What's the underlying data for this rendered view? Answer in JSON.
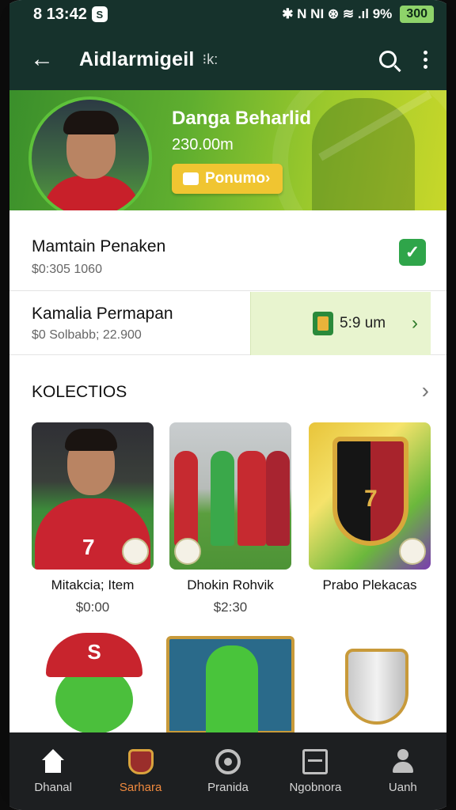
{
  "status_bar": {
    "time": "8 13:42",
    "app_badge": "S",
    "icons_text": "✱ N NI ⊛ ≋ .ıl 9%",
    "battery": "300"
  },
  "app_bar": {
    "title": "Aidlarmigeil",
    "title_tag": "⁝k:",
    "back_icon": "arrow-left-icon",
    "search_icon": "search-icon",
    "menu_icon": "more-vert-icon"
  },
  "hero": {
    "name": "Danga Beharlid",
    "subtitle": "230.00m",
    "promo_button": "Ponumo›"
  },
  "rows": [
    {
      "title": "Mamtain Penaken",
      "subtitle": "$0:305 1060",
      "status_icon": "verified-check-icon"
    },
    {
      "title": "Kamalia Permapan",
      "subtitle": "$0 Solbabb; 22.900",
      "offer_text": "5:9 um",
      "offer_icon": "coin-icon"
    }
  ],
  "collections": {
    "title": "KOLECTIOS",
    "items": [
      {
        "title": "Mitakcia; Item",
        "price": "$0:00",
        "jersey_number": "7"
      },
      {
        "title": "Dhokin Rohvik",
        "price": "$2:30"
      },
      {
        "title": "Prabo Plekacas",
        "price": "",
        "badge_number": "7"
      }
    ],
    "second_row_labels": [
      "S",
      "",
      ""
    ]
  },
  "bottom_nav": [
    {
      "label": "Dhanal",
      "icon": "home-icon",
      "active": false
    },
    {
      "label": "Sarhara",
      "icon": "shop-icon",
      "active": true
    },
    {
      "label": "Pranida",
      "icon": "target-icon",
      "active": false
    },
    {
      "label": "Ngobnora",
      "icon": "list-icon",
      "active": false
    },
    {
      "label": "Uanh",
      "icon": "user-icon",
      "active": false
    }
  ],
  "colors": {
    "app_bar": "#16322c",
    "hero_gradient_start": "#3a8f2b",
    "hero_gradient_end": "#c8d72a",
    "promo_button": "#f0c531",
    "accent_active": "#f08a3e",
    "bottom_nav": "#1d1f21"
  }
}
